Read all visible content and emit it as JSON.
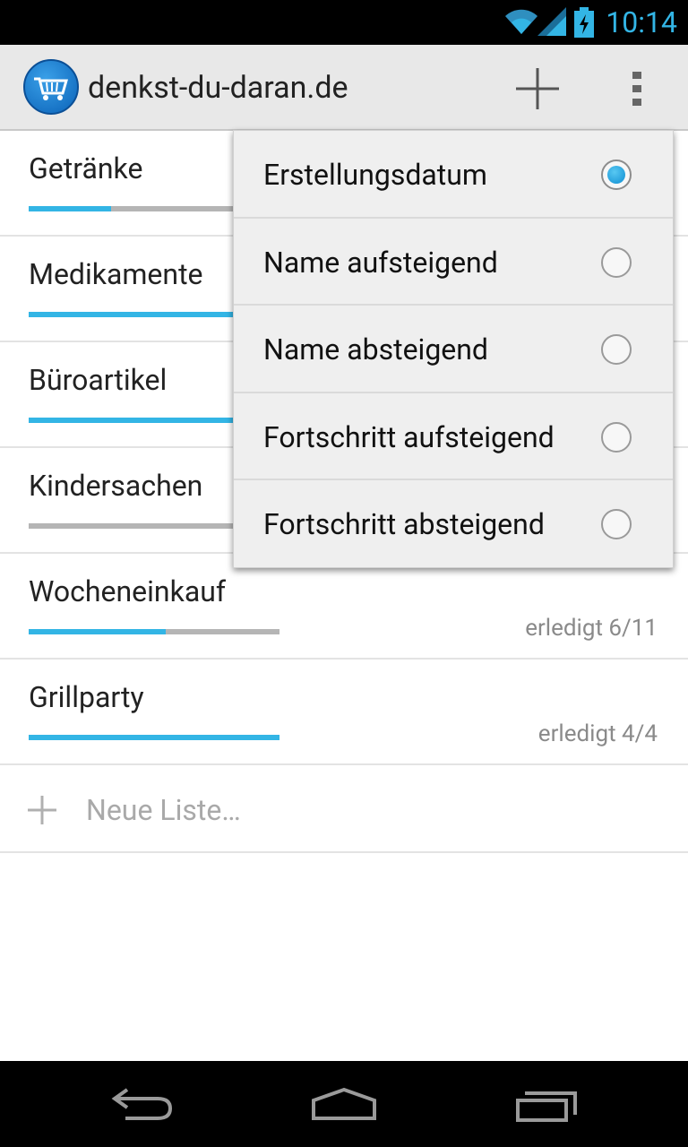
{
  "status_bar": {
    "time": "10:14",
    "icons": [
      "wifi-icon",
      "signal-icon",
      "battery-charging-icon"
    ]
  },
  "action_bar": {
    "title": "denkst-du-daran.de",
    "logo_icon": "shopping-cart-icon",
    "add_icon": "plus-icon",
    "overflow_icon": "overflow-menu-icon"
  },
  "lists": [
    {
      "name": "Getränke",
      "progress": 0.33,
      "status": ""
    },
    {
      "name": "Medikamente",
      "progress": 1.0,
      "status": ""
    },
    {
      "name": "Büroartikel",
      "progress": 1.0,
      "status": ""
    },
    {
      "name": "Kindersachen",
      "progress": 0.0,
      "status": ""
    },
    {
      "name": "Wocheneinkauf",
      "progress": 0.545,
      "status": "erledigt 6/11"
    },
    {
      "name": "Grillparty",
      "progress": 1.0,
      "status": "erledigt 4/4"
    }
  ],
  "new_list": {
    "label": "Neue Liste…"
  },
  "sort_menu": {
    "options": [
      {
        "label": "Erstellungsdatum",
        "selected": true
      },
      {
        "label": "Name aufsteigend",
        "selected": false
      },
      {
        "label": "Name absteigend",
        "selected": false
      },
      {
        "label": "Fortschritt aufsteigend",
        "selected": false
      },
      {
        "label": "Fortschritt absteigend",
        "selected": false
      }
    ]
  },
  "colors": {
    "accent": "#33b5e5",
    "track": "#b5b5b5",
    "actionbar": "#e8e8e8"
  },
  "nav_bar": {
    "icons": [
      "back-icon",
      "home-icon",
      "recent-apps-icon"
    ]
  }
}
